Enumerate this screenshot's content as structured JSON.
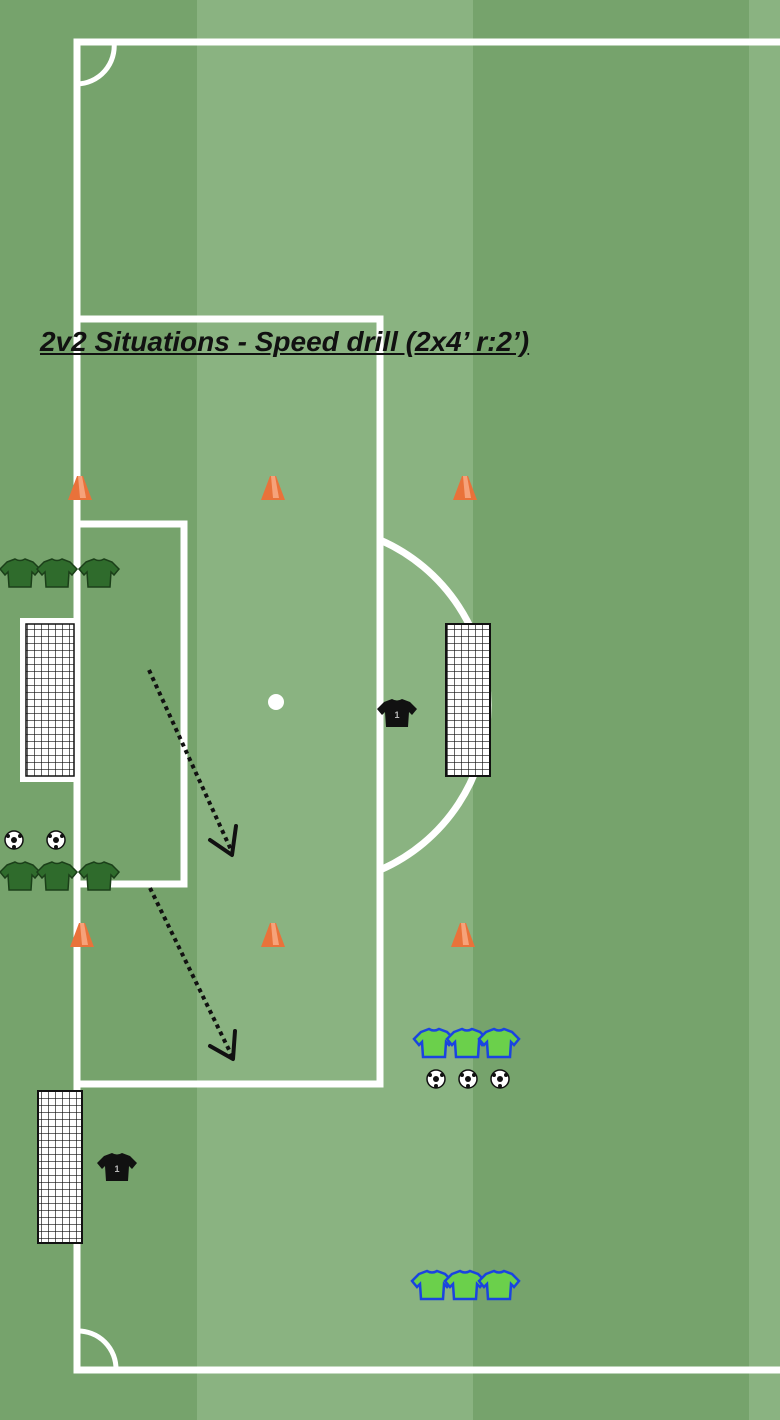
{
  "title": "2v2 Situations - Speed drill (2x4’ r:2’)",
  "colors": {
    "pitch_dark": "#76a36c",
    "pitch_light": "#8ab381",
    "lines": "#ffffff",
    "team_dark_green": "#2f6b2c",
    "team_light_green": "#6bd04b",
    "team_light_outline": "#1a44e0",
    "goalkeeper": "#111111",
    "cone": "#e9723a",
    "arrow": "#111111"
  },
  "goalkeeper_numbers": [
    "1",
    "1"
  ],
  "icons": [
    "cone-icon",
    "goal-net-icon",
    "player-shirt-icon",
    "goalkeeper-shirt-icon",
    "ball-icon",
    "run-arrow-icon"
  ]
}
